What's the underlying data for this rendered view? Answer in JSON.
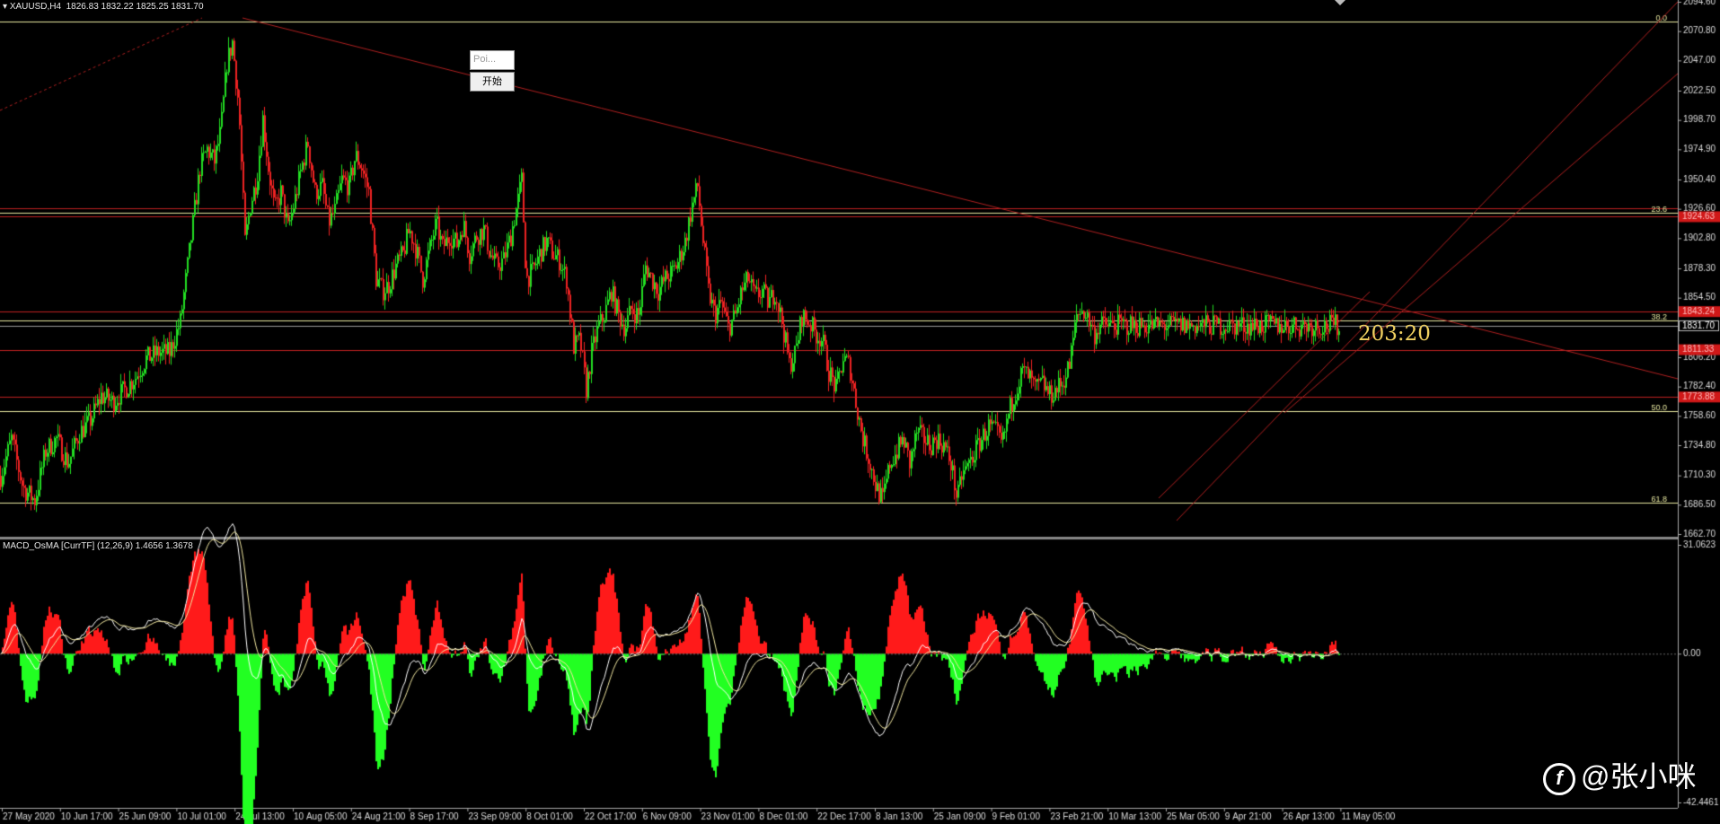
{
  "header": {
    "symbol": "XAUUSD,H4",
    "ohlc": "1826.83 1832.22 1825.25 1831.70",
    "indicator": "MACD_OsMA [CurrTF] (12,26,9) 1.4656 1.3678"
  },
  "controls": {
    "input_text": "Poi...",
    "start_button": "开始"
  },
  "timer": "203:20",
  "watermark": "@张小咪",
  "watermark_logo": "f",
  "colors": {
    "background": "#000000",
    "up_candle": "#22dd22",
    "down_candle": "#ee2222",
    "trendline": "#b02020",
    "fib_line": "#e8e8a0",
    "hist_positive": "#ff1a1a",
    "hist_negative": "#22ff22",
    "macd_line": "#ffffff",
    "signal_line": "#f0e6a0",
    "price_tag": "#d01818"
  },
  "chart_data": [
    {
      "type": "candlestick",
      "price_axis": [
        "2094.60",
        "2070.80",
        "2047.00",
        "2022.50",
        "1998.70",
        "1974.90",
        "1950.40",
        "1926.60",
        "1902.80",
        "1878.30",
        "1854.50",
        "1830.70",
        "1806.20",
        "1782.40",
        "1758.60",
        "1734.80",
        "1710.30",
        "1686.50",
        "1662.70"
      ],
      "ylim": [
        1662.7,
        2094.6
      ],
      "time_axis": [
        "27 May 2020",
        "10 Jun 17:00",
        "25 Jun 09:00",
        "10 Jul 01:00",
        "24 Jul 13:00",
        "10 Aug 05:00",
        "24 Aug 21:00",
        "8 Sep 17:00",
        "23 Sep 09:00",
        "8 Oct 01:00",
        "22 Oct 17:00",
        "6 Nov 09:00",
        "23 Nov 01:00",
        "8 Dec 01:00",
        "22 Dec 17:00",
        "8 Jan 13:00",
        "25 Jan 09:00",
        "9 Feb 01:00",
        "23 Feb 21:00",
        "10 Mar 13:00",
        "25 Mar 05:00",
        "9 Apr 21:00",
        "26 Apr 13:00",
        "11 May 05:00"
      ],
      "close_path": [
        [
          0,
          1710
        ],
        [
          12,
          1740
        ],
        [
          25,
          1700
        ],
        [
          38,
          1690
        ],
        [
          50,
          1730
        ],
        [
          62,
          1740
        ],
        [
          75,
          1720
        ],
        [
          88,
          1745
        ],
        [
          100,
          1755
        ],
        [
          112,
          1775
        ],
        [
          125,
          1770
        ],
        [
          138,
          1780
        ],
        [
          150,
          1790
        ],
        [
          162,
          1805
        ],
        [
          175,
          1810
        ],
        [
          188,
          1810
        ],
        [
          200,
          1835
        ],
        [
          208,
          1880
        ],
        [
          215,
          1920
        ],
        [
          222,
          1960
        ],
        [
          230,
          1975
        ],
        [
          238,
          1965
        ],
        [
          245,
          1990
        ],
        [
          252,
          2045
        ],
        [
          258,
          2062
        ],
        [
          265,
          2010
        ],
        [
          272,
          1900
        ],
        [
          278,
          1930
        ],
        [
          285,
          1950
        ],
        [
          292,
          2000
        ],
        [
          298,
          1960
        ],
        [
          305,
          1925
        ],
        [
          312,
          1940
        ],
        [
          320,
          1910
        ],
        [
          328,
          1935
        ],
        [
          335,
          1960
        ],
        [
          342,
          1980
        ],
        [
          350,
          1940
        ],
        [
          358,
          1945
        ],
        [
          365,
          1915
        ],
        [
          372,
          1925
        ],
        [
          380,
          1950
        ],
        [
          388,
          1945
        ],
        [
          395,
          1970
        ],
        [
          402,
          1960
        ],
        [
          410,
          1940
        ],
        [
          418,
          1870
        ],
        [
          425,
          1860
        ],
        [
          432,
          1865
        ],
        [
          440,
          1880
        ],
        [
          448,
          1890
        ],
        [
          455,
          1910
        ],
        [
          462,
          1895
        ],
        [
          470,
          1870
        ],
        [
          478,
          1895
        ],
        [
          485,
          1915
        ],
        [
          492,
          1895
        ],
        [
          500,
          1905
        ],
        [
          508,
          1898
        ],
        [
          515,
          1915
        ],
        [
          522,
          1890
        ],
        [
          530,
          1905
        ],
        [
          538,
          1910
        ],
        [
          545,
          1890
        ],
        [
          552,
          1880
        ],
        [
          560,
          1885
        ],
        [
          568,
          1905
        ],
        [
          575,
          1930
        ],
        [
          580,
          1950
        ],
        [
          585,
          1870
        ],
        [
          592,
          1875
        ],
        [
          600,
          1890
        ],
        [
          608,
          1900
        ],
        [
          615,
          1890
        ],
        [
          622,
          1885
        ],
        [
          630,
          1870
        ],
        [
          638,
          1815
        ],
        [
          645,
          1820
        ],
        [
          652,
          1780
        ],
        [
          658,
          1810
        ],
        [
          665,
          1830
        ],
        [
          672,
          1840
        ],
        [
          680,
          1860
        ],
        [
          688,
          1840
        ],
        [
          695,
          1830
        ],
        [
          702,
          1845
        ],
        [
          710,
          1840
        ],
        [
          718,
          1880
        ],
        [
          725,
          1870
        ],
        [
          732,
          1860
        ],
        [
          740,
          1870
        ],
        [
          748,
          1875
        ],
        [
          755,
          1885
        ],
        [
          762,
          1900
        ],
        [
          770,
          1930
        ],
        [
          776,
          1945
        ],
        [
          782,
          1900
        ],
        [
          788,
          1860
        ],
        [
          795,
          1840
        ],
        [
          802,
          1850
        ],
        [
          810,
          1830
        ],
        [
          818,
          1840
        ],
        [
          825,
          1860
        ],
        [
          832,
          1870
        ],
        [
          840,
          1855
        ],
        [
          848,
          1860
        ],
        [
          855,
          1850
        ],
        [
          862,
          1860
        ],
        [
          870,
          1835
        ],
        [
          878,
          1800
        ],
        [
          885,
          1810
        ],
        [
          892,
          1840
        ],
        [
          900,
          1835
        ],
        [
          908,
          1825
        ],
        [
          915,
          1820
        ],
        [
          922,
          1795
        ],
        [
          930,
          1780
        ],
        [
          938,
          1805
        ],
        [
          945,
          1800
        ],
        [
          952,
          1770
        ],
        [
          960,
          1740
        ],
        [
          968,
          1720
        ],
        [
          975,
          1700
        ],
        [
          982,
          1690
        ],
        [
          990,
          1720
        ],
        [
          998,
          1730
        ],
        [
          1005,
          1740
        ],
        [
          1012,
          1720
        ],
        [
          1020,
          1745
        ],
        [
          1028,
          1740
        ],
        [
          1035,
          1735
        ],
        [
          1042,
          1740
        ],
        [
          1050,
          1735
        ],
        [
          1058,
          1720
        ],
        [
          1065,
          1690
        ],
        [
          1070,
          1710
        ],
        [
          1078,
          1720
        ],
        [
          1085,
          1730
        ],
        [
          1092,
          1740
        ],
        [
          1100,
          1750
        ],
        [
          1108,
          1745
        ],
        [
          1115,
          1735
        ],
        [
          1122,
          1760
        ],
        [
          1130,
          1780
        ],
        [
          1138,
          1795
        ],
        [
          1145,
          1790
        ],
        [
          1152,
          1780
        ],
        [
          1160,
          1785
        ],
        [
          1168,
          1775
        ],
        [
          1175,
          1780
        ],
        [
          1182,
          1785
        ],
        [
          1190,
          1800
        ],
        [
          1198,
          1840
        ],
        [
          1205,
          1845
        ],
        [
          1212,
          1835
        ],
        [
          1218,
          1825
        ],
        [
          1223,
          1832
        ]
      ]
    },
    {
      "type": "bar",
      "title": "MACD_OsMA [CurrTF] (12,26,9) 1.4656 1.3678",
      "axis_labels": [
        "31.0623",
        "0.00",
        "-42.4461"
      ],
      "ylim": [
        -42.4461,
        31.0623
      ]
    }
  ],
  "fibonacci": [
    {
      "label": "0.0",
      "price": 2078.5
    },
    {
      "label": "23.6",
      "price": 1923.8
    },
    {
      "label": "38.2",
      "price": 1836.4
    },
    {
      "label": "50.0",
      "price": 1762.4
    },
    {
      "label": "61.8",
      "price": 1688.4
    }
  ],
  "price_levels": [
    {
      "label": "1924.63",
      "price": 1920.2
    },
    {
      "label": "1843.24",
      "price": 1843.2
    },
    {
      "label": "1831.70",
      "price": 1831.7
    },
    {
      "label": "1811.33",
      "price": 1812.3
    },
    {
      "label": "1773.88",
      "price": 1773.9
    }
  ]
}
